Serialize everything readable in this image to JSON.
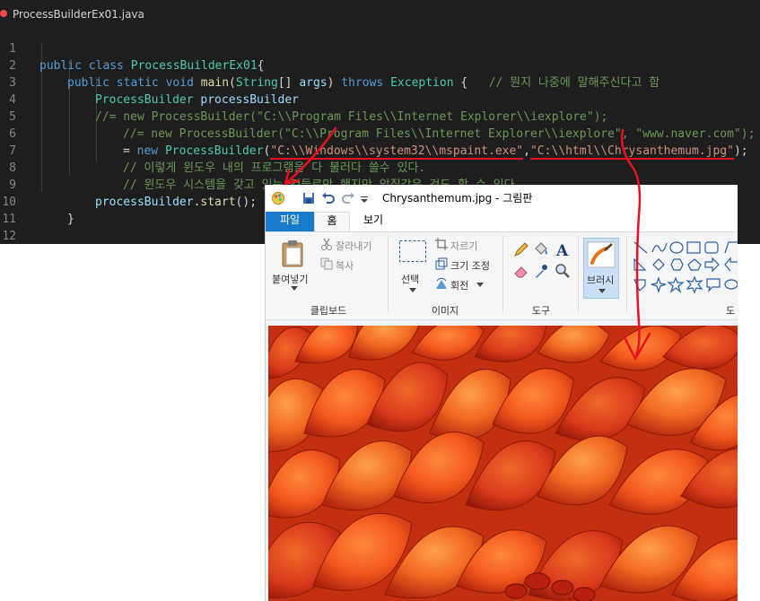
{
  "editor": {
    "tab_title": "ProcessBuilderEx01.java",
    "line_numbers": [
      "1",
      "2",
      "3",
      "4",
      "5",
      "6",
      "7",
      "8",
      "9",
      "10",
      "11",
      "12"
    ],
    "line1": {
      "kw1": "public",
      "kw2": "class",
      "cls": "ProcessBuilderEx01",
      "brace": "{"
    },
    "line2": {
      "kw1": "public",
      "kw2": "static",
      "kw3": "void",
      "fn": "main",
      "p1": "(",
      "ty1": "String",
      "p2": "[] ",
      "var": "args",
      "p3": ") ",
      "kw4": "throws",
      "ty2": "Exception",
      "p4": " {",
      "comment": "// 뭔지 나중에 말해주신다고 함"
    },
    "line3": {
      "ty": "ProcessBuilder",
      "var": "processBuilder"
    },
    "line4": {
      "comment": "//= new ProcessBuilder(\"C:\\\\Program Files\\\\Internet Explorer\\\\iexplore\");"
    },
    "line5": {
      "comment": "//= new ProcessBuilder(\"C:\\\\Program Files\\\\Internet Explorer\\\\iexplore\", \"www.naver.com\");"
    },
    "line6": {
      "eq": "= ",
      "kw": "new",
      "ty": "ProcessBuilder",
      "p1": "(",
      "str1": "\"C:\\\\Windows\\\\system32\\\\mspaint.exe\"",
      "comma": ",",
      "str2": "\"C:\\\\html\\\\Chrysanthemum.jpg\"",
      "p2": ");"
    },
    "line7": {
      "comment": "// 이렇게 윈도우 내의 프로그램을 다 불러다 쓸수 있다."
    },
    "line8": {
      "comment": "// 윈도우 시스템을 갖고 있는 것들로만 했지만 앞집같은 것도 할 수 있다."
    },
    "line9": {
      "var": "processBuilder",
      "p1": ".",
      "fn": "start",
      "p2": "();"
    },
    "line10": {
      "brace": "}"
    },
    "line12": {
      "brace": "}"
    }
  },
  "paint": {
    "window_title": "Chrysanthemum.jpg - 그림판",
    "tabs": {
      "file": "파일",
      "home": "홈",
      "view": "보기"
    },
    "clipboard": {
      "paste": "붙여넣기",
      "cut": "잘라내기",
      "copy": "복사",
      "group": "클립보드"
    },
    "image": {
      "select": "선택",
      "crop": "자르기",
      "resize": "크기 조정",
      "rotate": "회전",
      "group": "이미지"
    },
    "tools": {
      "group": "도구"
    },
    "brushes": {
      "label": "브러시"
    },
    "shapes": {
      "group_partial": "도"
    }
  },
  "colors": {
    "editor_bg": "#1e1e1e",
    "keyword": "#569cd6",
    "type": "#4ec9b0",
    "string": "#ce9178",
    "comment": "#6a9955",
    "annotation_red": "#e81123",
    "ribbon_file_tab": "#1979ca"
  }
}
